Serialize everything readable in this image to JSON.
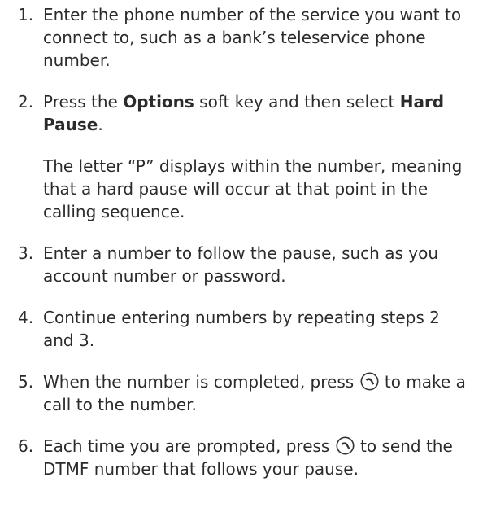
{
  "steps": [
    {
      "number": "1.",
      "text": "Enter the phone number of the service you want to connect to, such as a bank’s teleservice phone number."
    },
    {
      "number": "2.",
      "text_before": "Press the ",
      "bold_1": "Options",
      "text_middle": " soft key and then select ",
      "bold_2": "Hard Pause",
      "text_after": ".",
      "note": "The letter “P” displays within the number, meaning that a hard pause will occur at that point in the calling sequence."
    },
    {
      "number": "3.",
      "text": "Enter a number to follow the pause, such as you account number or password."
    },
    {
      "number": "4.",
      "text": "Continue entering numbers by repeating steps 2 and 3."
    },
    {
      "number": "5.",
      "text_before": "When the number is completed, press ",
      "icon": "send-key-icon",
      "text_after": " to make a call to the number."
    },
    {
      "number": "6.",
      "text_before": "Each time you are prompted, press ",
      "icon": "send-key-icon",
      "text_after": " to send the DTMF number that follows your pause."
    }
  ]
}
